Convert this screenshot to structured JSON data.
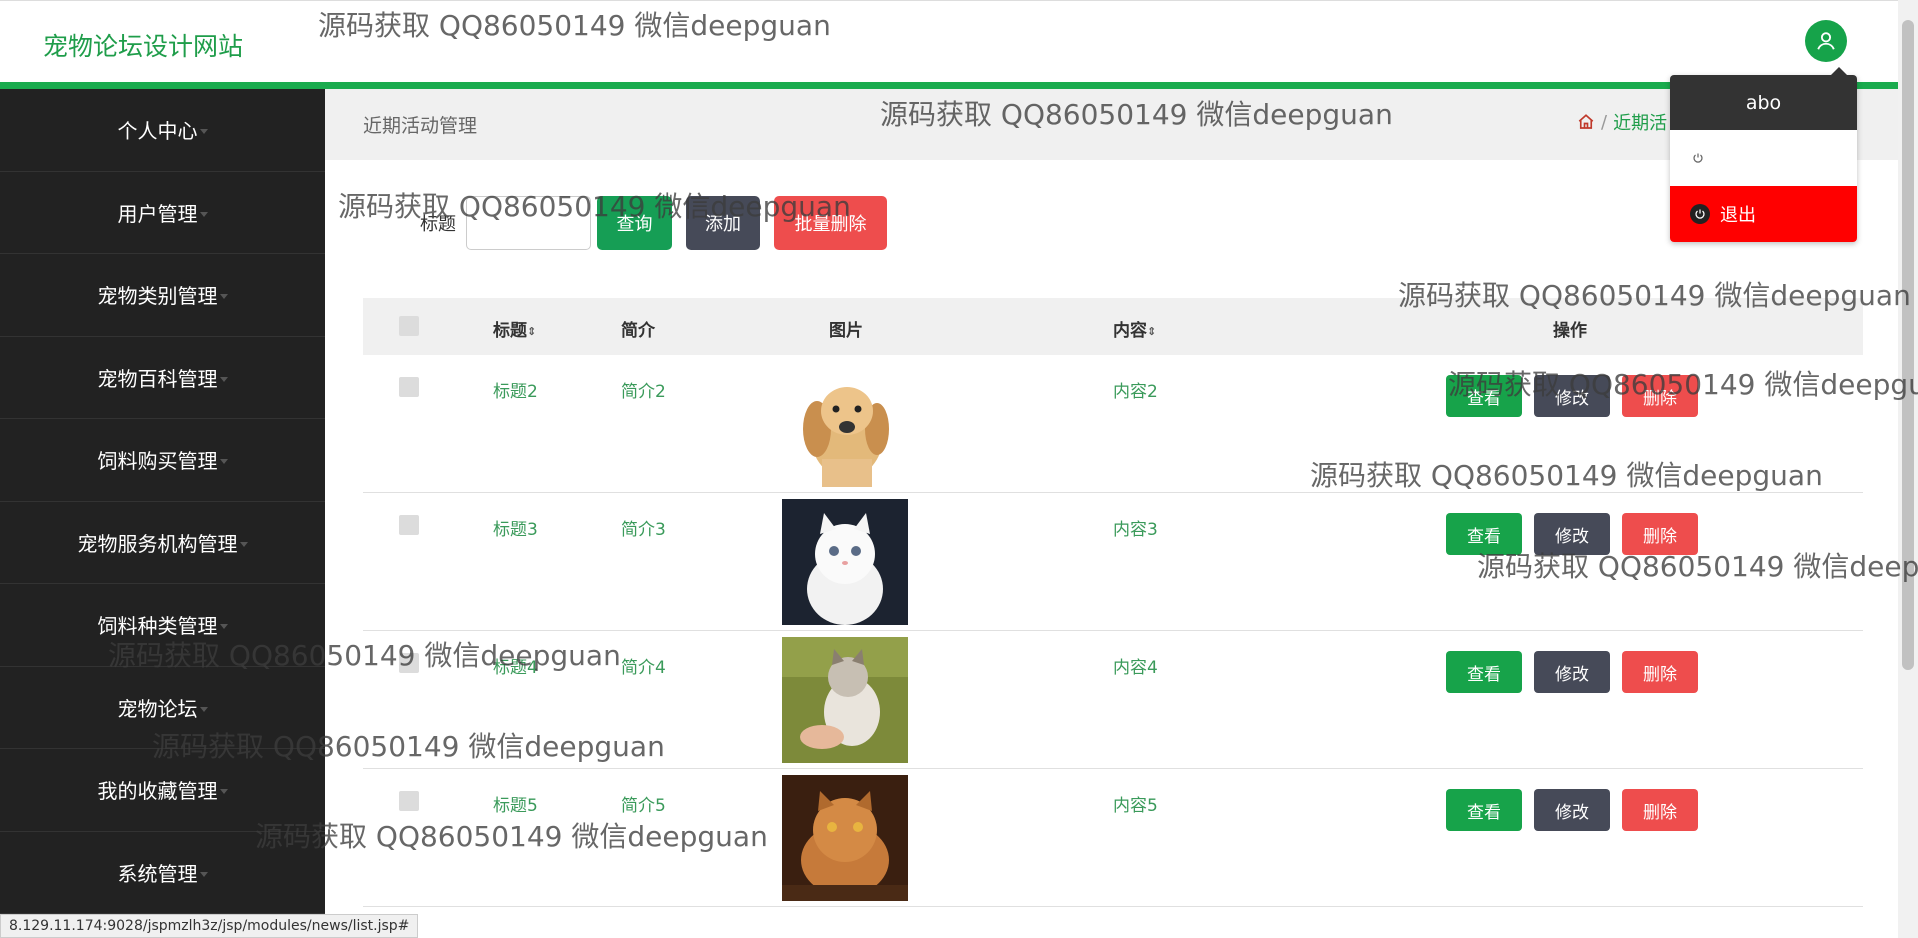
{
  "header": {
    "brand": "宠物论坛设计网站",
    "user_icon": "user-icon"
  },
  "sidebar": {
    "items": [
      {
        "label": "个人中心"
      },
      {
        "label": "用户管理"
      },
      {
        "label": "宠物类别管理"
      },
      {
        "label": "宠物百科管理"
      },
      {
        "label": "饲料购买管理"
      },
      {
        "label": "宠物服务机构管理"
      },
      {
        "label": "饲料种类管理"
      },
      {
        "label": "宠物论坛"
      },
      {
        "label": "我的收藏管理"
      },
      {
        "label": "系统管理"
      }
    ]
  },
  "breadcrumb": {
    "title": "近期活动管理",
    "separator": "/",
    "link": "近期活"
  },
  "search": {
    "label": "标题",
    "value": "",
    "query": "查询",
    "add": "添加",
    "batch_delete": "批量删除"
  },
  "table": {
    "headers": {
      "title": "标题",
      "intro": "简介",
      "image": "图片",
      "content": "内容",
      "ops": "操作",
      "sort_icon": "⇕"
    },
    "ops": {
      "view": "查看",
      "edit": "修改",
      "delete": "删除"
    },
    "rows": [
      {
        "title": "标题2",
        "intro": "简介2",
        "content": "内容2",
        "image": "dog"
      },
      {
        "title": "标题3",
        "intro": "简介3",
        "content": "内容3",
        "image": "white-cat"
      },
      {
        "title": "标题4",
        "intro": "简介4",
        "content": "内容4",
        "image": "kitten"
      },
      {
        "title": "标题5",
        "intro": "简介5",
        "content": "内容5",
        "image": "persian-cat"
      }
    ]
  },
  "dropdown": {
    "username": "abo",
    "logout": "退出"
  },
  "status_url": "8.129.11.174:9028/jspmzlh3z/jsp/modules/news/list.jsp#",
  "watermark": "源码获取 QQ86050149 微信deepguan",
  "colors": {
    "brand_green": "#1aab4e",
    "danger": "#ee4d4d",
    "dark": "#464a58"
  }
}
